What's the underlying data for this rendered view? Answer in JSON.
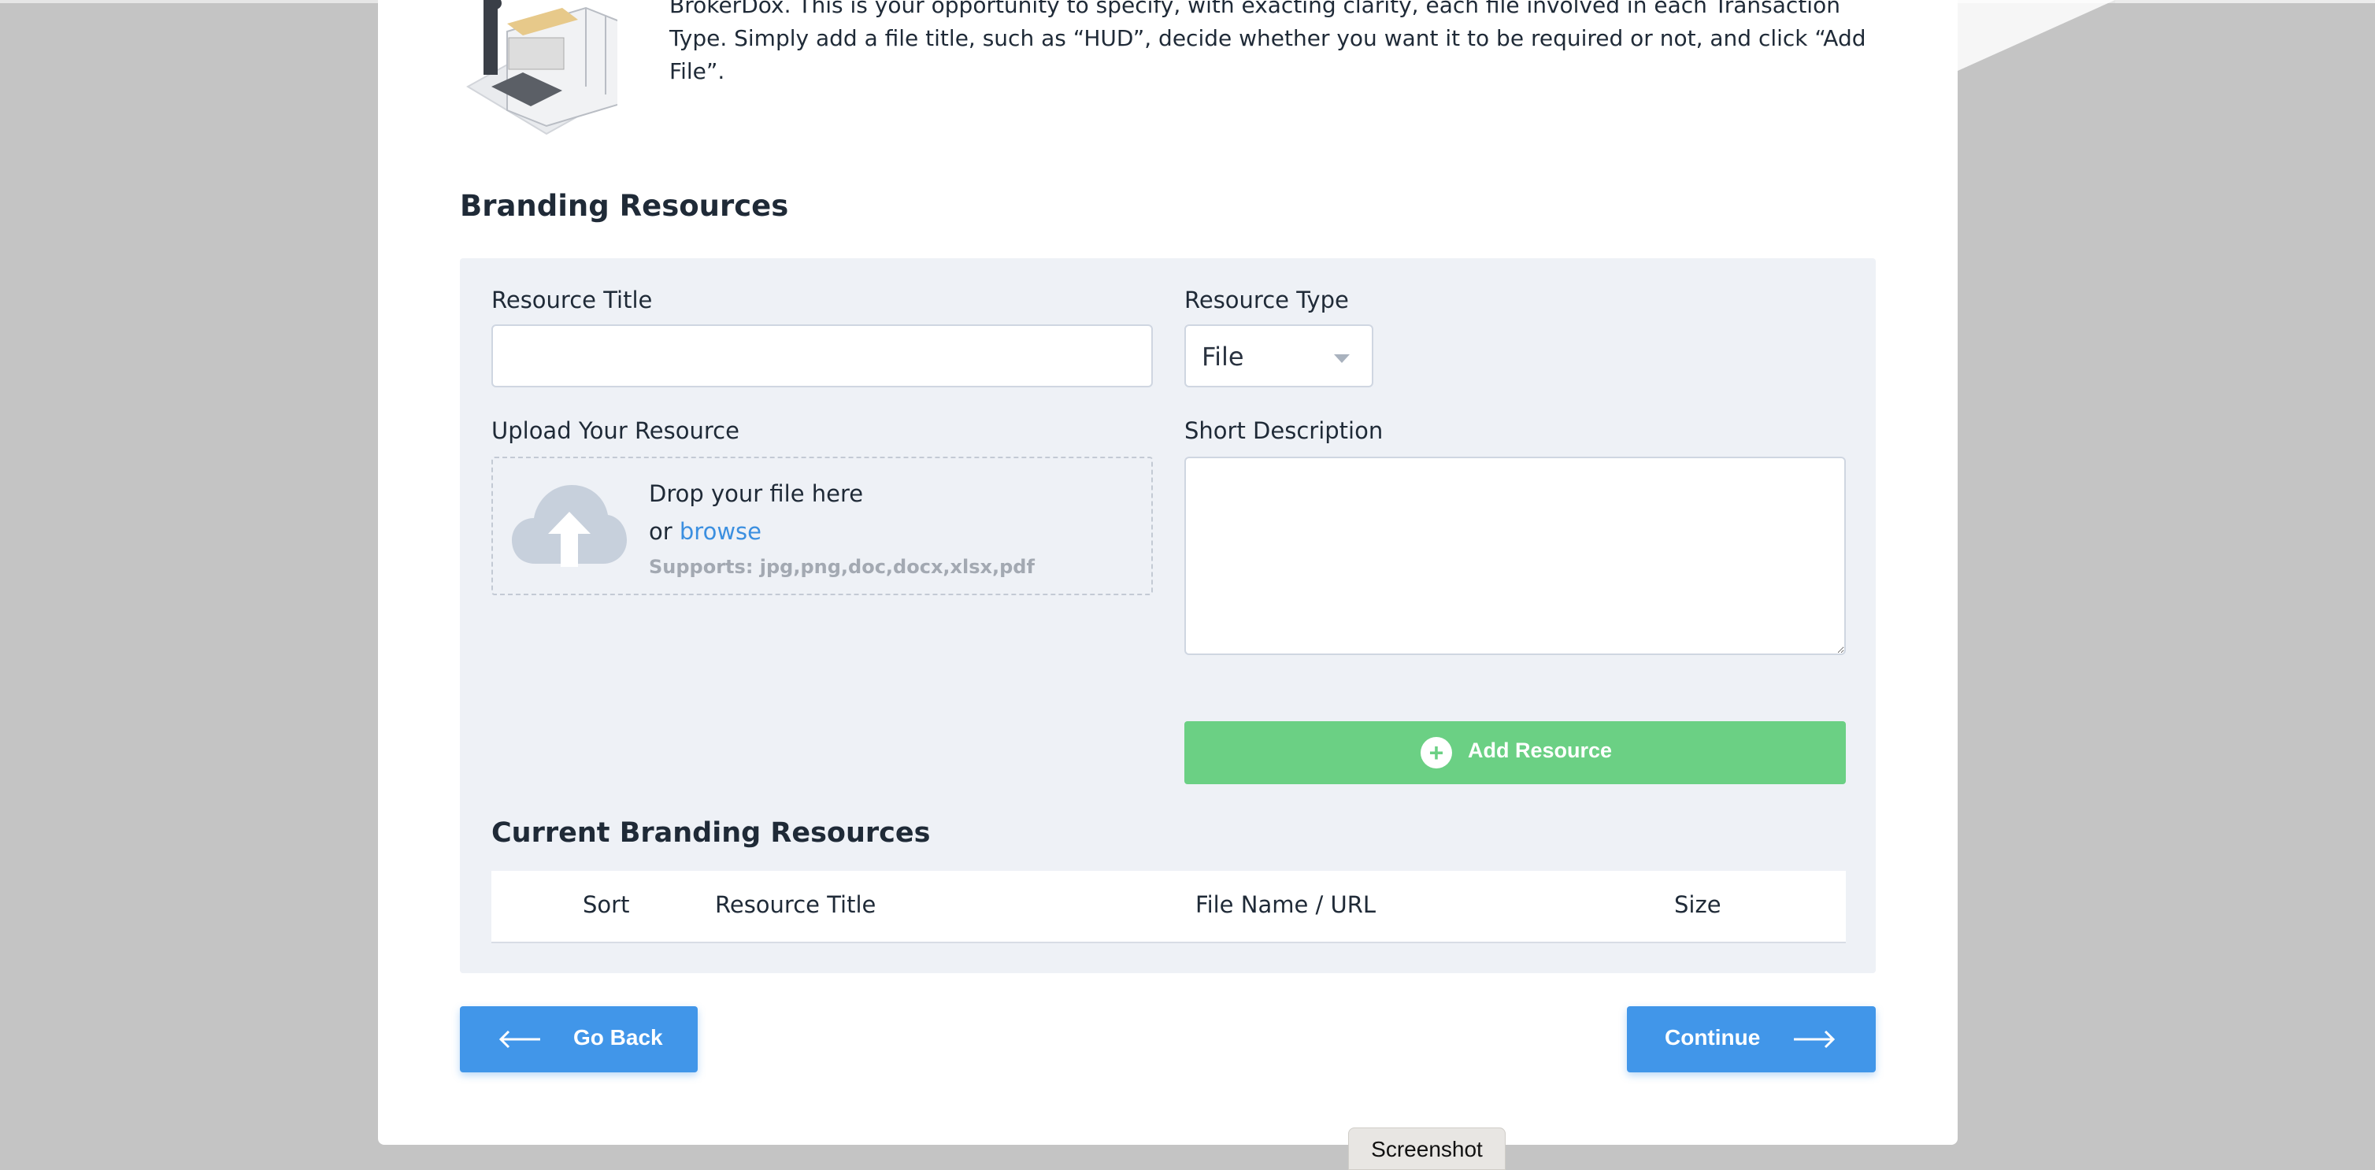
{
  "intro": {
    "text": "BrokerDox. This is your opportunity to specify, with exacting clarity, each file involved in each Transaction Type. Simply add a file title, such as “HUD”, decide whether you want it to be required or not, and click “Add File”."
  },
  "section": {
    "title": "Branding Resources"
  },
  "form": {
    "resource_title_label": "Resource Title",
    "resource_title_value": "",
    "resource_type_label": "Resource Type",
    "resource_type_value": "File",
    "upload_label": "Upload Your Resource",
    "drop_text": "Drop your file here",
    "or_text": "or",
    "browse_text": "browse",
    "supports_text": "Supports: jpg,png,doc,docx,xlsx,pdf",
    "short_description_label": "Short Description",
    "short_description_value": "",
    "add_button_label": "Add Resource"
  },
  "current": {
    "title": "Current Branding Resources",
    "columns": [
      "Sort",
      "Resource Title",
      "File Name / URL",
      "Size"
    ]
  },
  "nav": {
    "back_label": "Go Back",
    "continue_label": "Continue"
  },
  "tooltip": {
    "text": "Screenshot"
  },
  "colors": {
    "accent_blue": "#4196e9",
    "add_green": "#6bd084",
    "link_blue": "#3b8fe0",
    "panel_bg": "#eef1f6"
  }
}
